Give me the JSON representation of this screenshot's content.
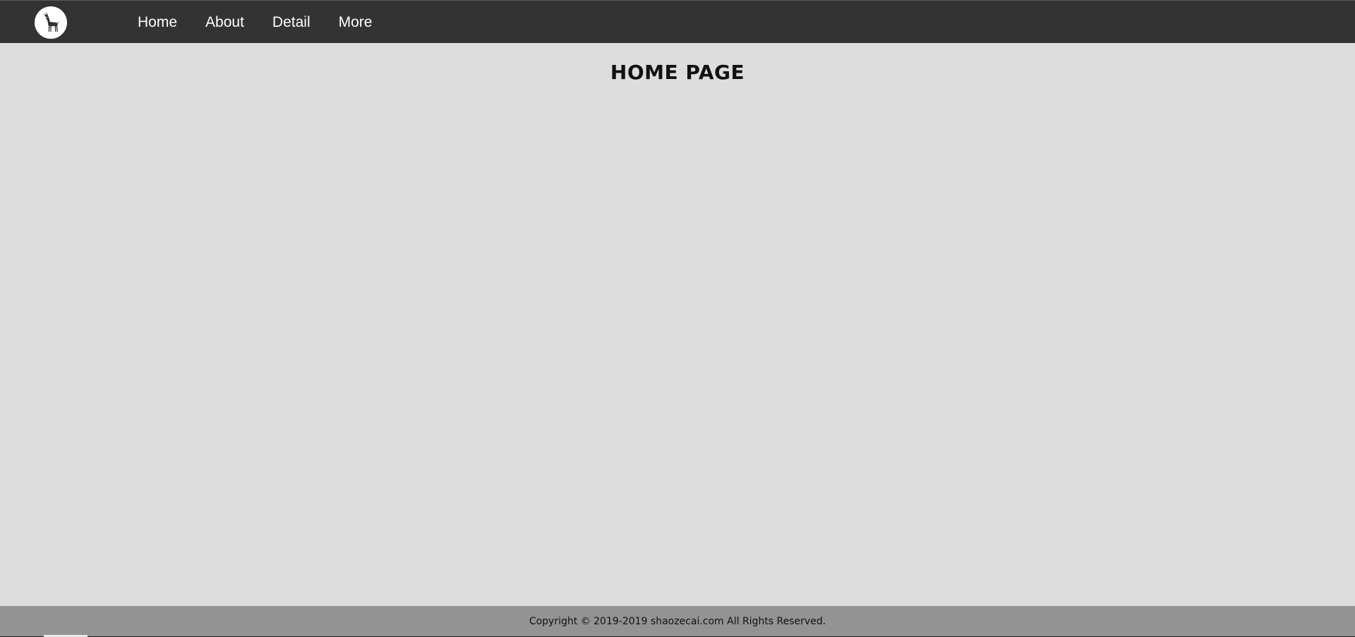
{
  "navbar": {
    "logo_icon": "deer-icon",
    "links": [
      {
        "label": "Home"
      },
      {
        "label": "About"
      },
      {
        "label": "Detail"
      },
      {
        "label": "More"
      }
    ]
  },
  "main": {
    "title": "HOME PAGE"
  },
  "footer": {
    "copyright": "Copyright © 2019-2019 shaozecai.com All Rights Reserved."
  },
  "colors": {
    "navbar_bg": "#333333",
    "page_bg": "#dddddd",
    "footer_bg": "#939393",
    "nav_text": "#ffffff"
  }
}
